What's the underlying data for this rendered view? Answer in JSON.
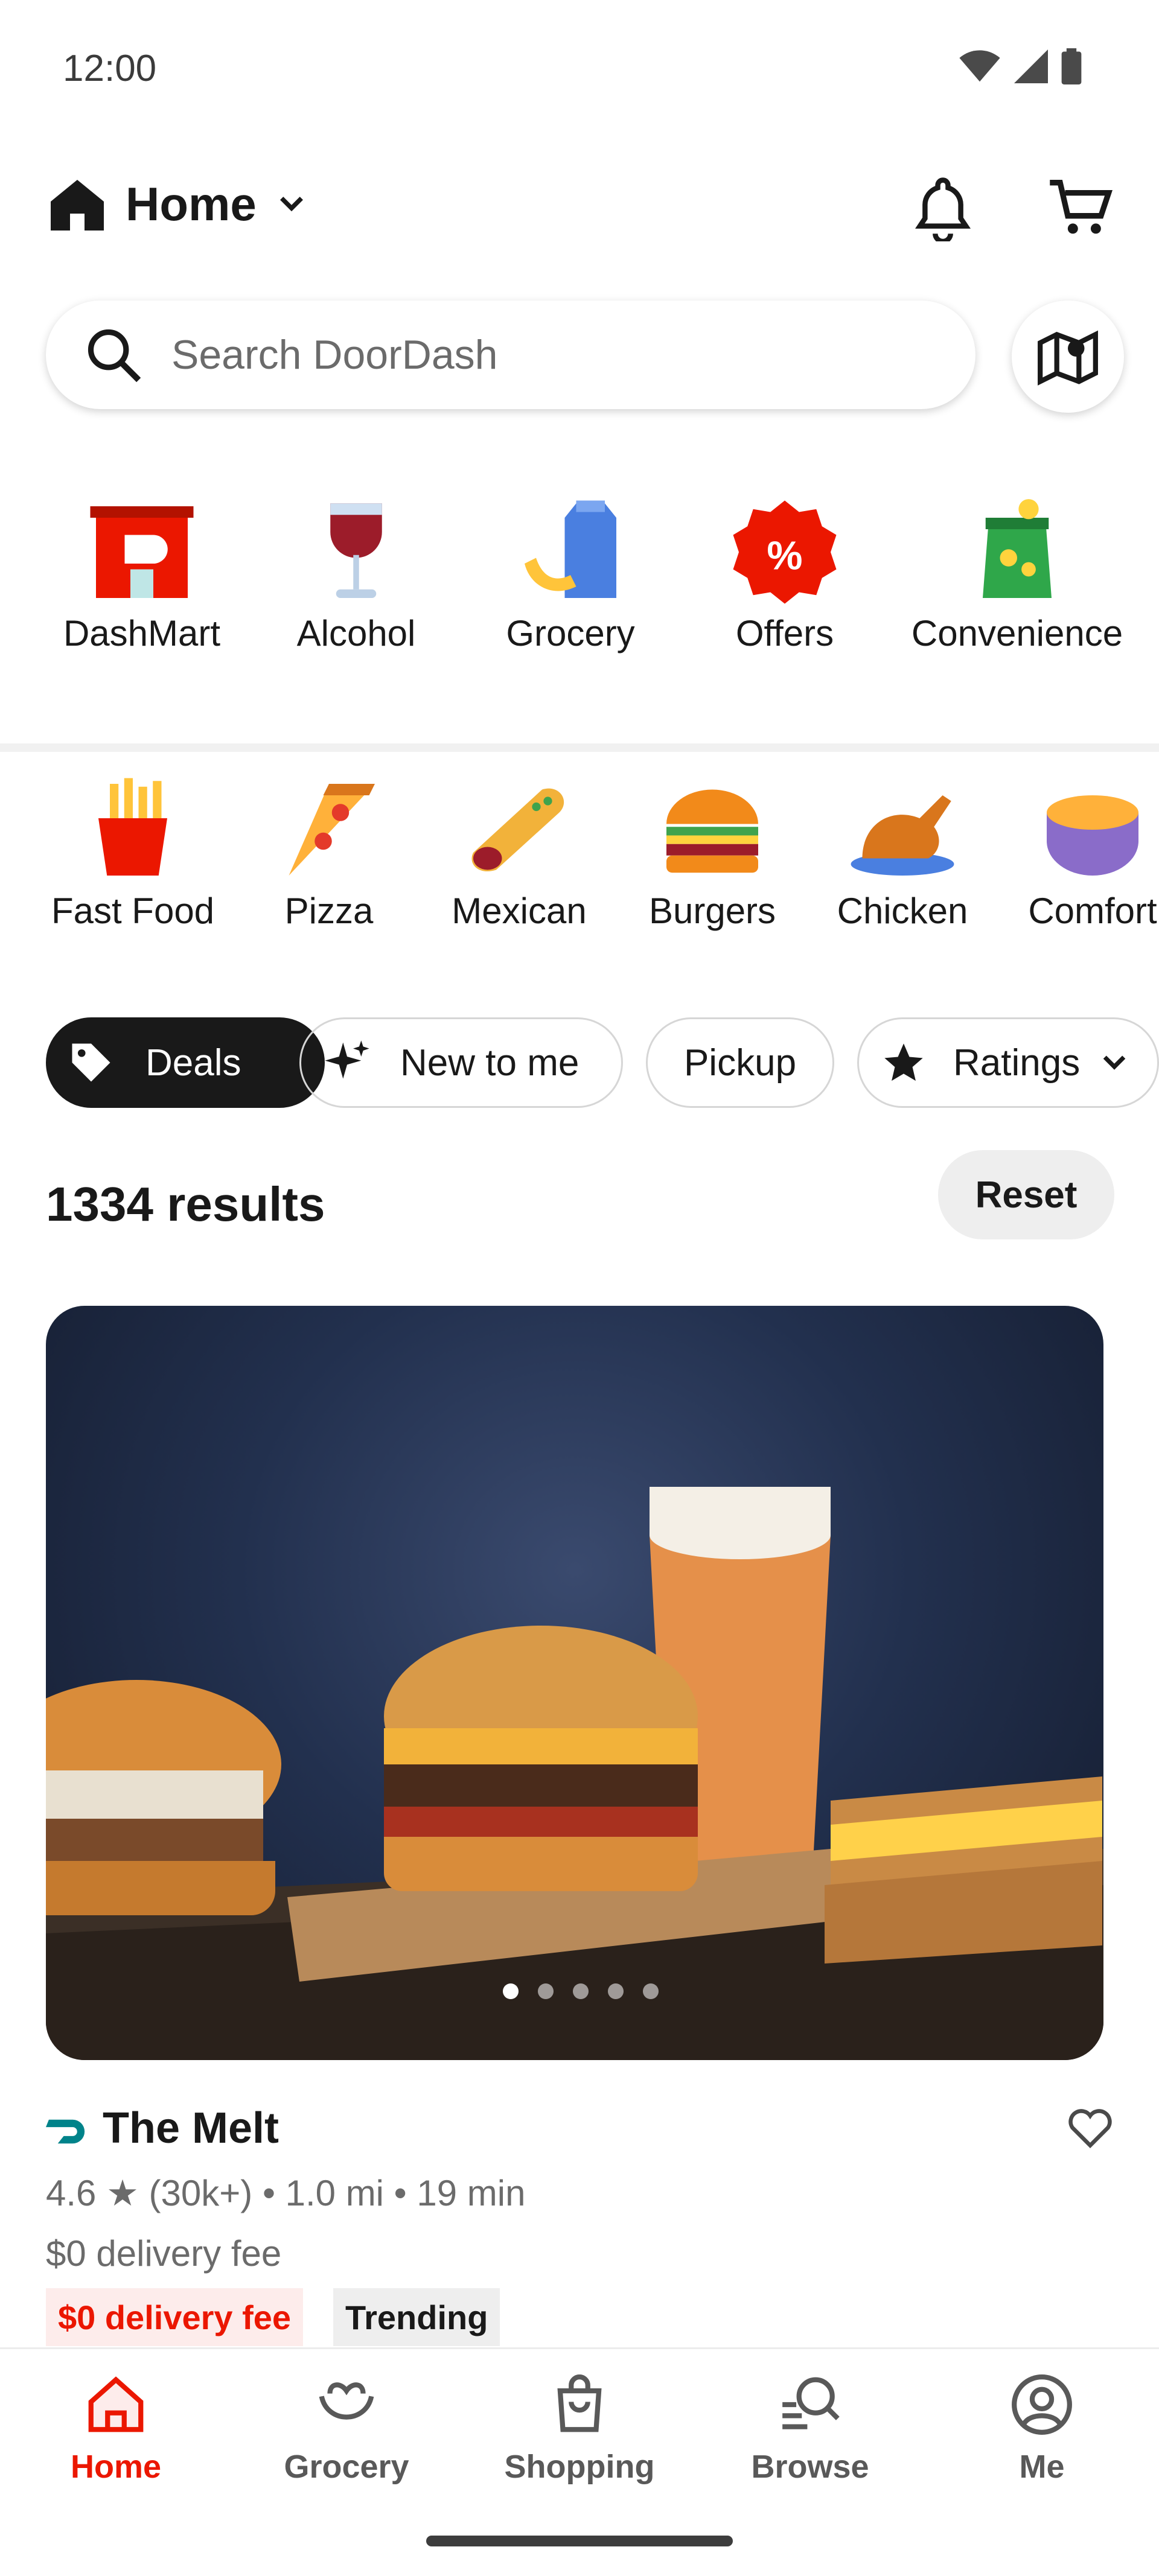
{
  "status_bar": {
    "time": "12:00"
  },
  "header": {
    "location_label": "Home"
  },
  "search": {
    "placeholder": "Search DoorDash"
  },
  "top_categories": [
    {
      "label": "DashMart",
      "icon": "dashmart-icon"
    },
    {
      "label": "Alcohol",
      "icon": "wine-glass-icon"
    },
    {
      "label": "Grocery",
      "icon": "grocery-icon"
    },
    {
      "label": "Offers",
      "icon": "offers-badge-icon"
    },
    {
      "label": "Convenience",
      "icon": "chips-bag-icon"
    }
  ],
  "cuisines": [
    {
      "label": "Fast Food",
      "icon": "fries-icon"
    },
    {
      "label": "Pizza",
      "icon": "pizza-slice-icon"
    },
    {
      "label": "Mexican",
      "icon": "burrito-icon"
    },
    {
      "label": "Burgers",
      "icon": "burger-icon"
    },
    {
      "label": "Chicken",
      "icon": "roast-chicken-icon"
    },
    {
      "label": "Comfort",
      "icon": "mac-and-cheese-icon"
    }
  ],
  "filters": {
    "deals": "Deals",
    "new_to_me": "New to me",
    "pickup": "Pickup",
    "ratings": "Ratings"
  },
  "results": {
    "count_text": "1334 results",
    "reset_label": "Reset"
  },
  "store": {
    "name": "The Melt",
    "rating": "4.6",
    "reviews": "(30k+)",
    "distance": "1.0 mi",
    "time": "19 min",
    "meta_text": "4.6 ★ (30k+) • 1.0 mi • 19 min",
    "delivery_fee": "$0 delivery fee",
    "badge_promo": "$0 delivery fee",
    "badge_trending": "Trending",
    "carousel_dots": 5,
    "carousel_active": 1
  },
  "bottom_nav": [
    {
      "label": "Home",
      "active": true
    },
    {
      "label": "Grocery",
      "active": false
    },
    {
      "label": "Shopping",
      "active": false
    },
    {
      "label": "Browse",
      "active": false
    },
    {
      "label": "Me",
      "active": false
    }
  ],
  "colors": {
    "brand_red": "#eb1700",
    "dark": "#191919",
    "dashpass_teal": "#00838a"
  }
}
